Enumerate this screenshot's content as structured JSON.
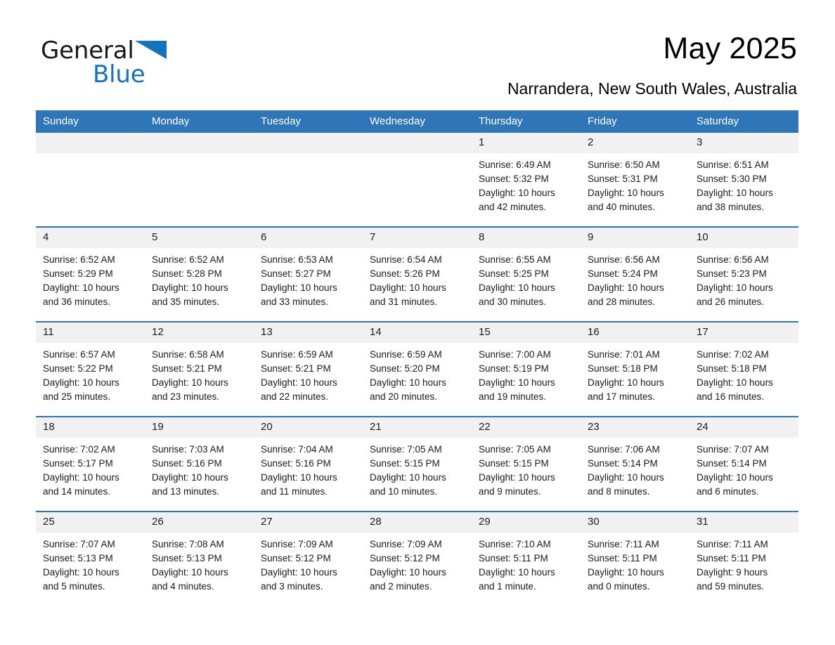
{
  "brand": {
    "name_part1": "General",
    "name_part2": "Blue",
    "accent_color": "#1273bf"
  },
  "header": {
    "month_title": "May 2025",
    "location": "Narrandera, New South Wales, Australia",
    "header_bg_color": "#2f76b8",
    "daynum_bg_color": "#f1f1f1"
  },
  "calendar": {
    "weekday_headers": [
      "Sunday",
      "Monday",
      "Tuesday",
      "Wednesday",
      "Thursday",
      "Friday",
      "Saturday"
    ],
    "weeks": [
      [
        {
          "day": "",
          "sunrise": "",
          "sunset": "",
          "daylight_line1": "",
          "daylight_line2": ""
        },
        {
          "day": "",
          "sunrise": "",
          "sunset": "",
          "daylight_line1": "",
          "daylight_line2": ""
        },
        {
          "day": "",
          "sunrise": "",
          "sunset": "",
          "daylight_line1": "",
          "daylight_line2": ""
        },
        {
          "day": "",
          "sunrise": "",
          "sunset": "",
          "daylight_line1": "",
          "daylight_line2": ""
        },
        {
          "day": "1",
          "sunrise": "Sunrise: 6:49 AM",
          "sunset": "Sunset: 5:32 PM",
          "daylight_line1": "Daylight: 10 hours",
          "daylight_line2": "and 42 minutes."
        },
        {
          "day": "2",
          "sunrise": "Sunrise: 6:50 AM",
          "sunset": "Sunset: 5:31 PM",
          "daylight_line1": "Daylight: 10 hours",
          "daylight_line2": "and 40 minutes."
        },
        {
          "day": "3",
          "sunrise": "Sunrise: 6:51 AM",
          "sunset": "Sunset: 5:30 PM",
          "daylight_line1": "Daylight: 10 hours",
          "daylight_line2": "and 38 minutes."
        }
      ],
      [
        {
          "day": "4",
          "sunrise": "Sunrise: 6:52 AM",
          "sunset": "Sunset: 5:29 PM",
          "daylight_line1": "Daylight: 10 hours",
          "daylight_line2": "and 36 minutes."
        },
        {
          "day": "5",
          "sunrise": "Sunrise: 6:52 AM",
          "sunset": "Sunset: 5:28 PM",
          "daylight_line1": "Daylight: 10 hours",
          "daylight_line2": "and 35 minutes."
        },
        {
          "day": "6",
          "sunrise": "Sunrise: 6:53 AM",
          "sunset": "Sunset: 5:27 PM",
          "daylight_line1": "Daylight: 10 hours",
          "daylight_line2": "and 33 minutes."
        },
        {
          "day": "7",
          "sunrise": "Sunrise: 6:54 AM",
          "sunset": "Sunset: 5:26 PM",
          "daylight_line1": "Daylight: 10 hours",
          "daylight_line2": "and 31 minutes."
        },
        {
          "day": "8",
          "sunrise": "Sunrise: 6:55 AM",
          "sunset": "Sunset: 5:25 PM",
          "daylight_line1": "Daylight: 10 hours",
          "daylight_line2": "and 30 minutes."
        },
        {
          "day": "9",
          "sunrise": "Sunrise: 6:56 AM",
          "sunset": "Sunset: 5:24 PM",
          "daylight_line1": "Daylight: 10 hours",
          "daylight_line2": "and 28 minutes."
        },
        {
          "day": "10",
          "sunrise": "Sunrise: 6:56 AM",
          "sunset": "Sunset: 5:23 PM",
          "daylight_line1": "Daylight: 10 hours",
          "daylight_line2": "and 26 minutes."
        }
      ],
      [
        {
          "day": "11",
          "sunrise": "Sunrise: 6:57 AM",
          "sunset": "Sunset: 5:22 PM",
          "daylight_line1": "Daylight: 10 hours",
          "daylight_line2": "and 25 minutes."
        },
        {
          "day": "12",
          "sunrise": "Sunrise: 6:58 AM",
          "sunset": "Sunset: 5:21 PM",
          "daylight_line1": "Daylight: 10 hours",
          "daylight_line2": "and 23 minutes."
        },
        {
          "day": "13",
          "sunrise": "Sunrise: 6:59 AM",
          "sunset": "Sunset: 5:21 PM",
          "daylight_line1": "Daylight: 10 hours",
          "daylight_line2": "and 22 minutes."
        },
        {
          "day": "14",
          "sunrise": "Sunrise: 6:59 AM",
          "sunset": "Sunset: 5:20 PM",
          "daylight_line1": "Daylight: 10 hours",
          "daylight_line2": "and 20 minutes."
        },
        {
          "day": "15",
          "sunrise": "Sunrise: 7:00 AM",
          "sunset": "Sunset: 5:19 PM",
          "daylight_line1": "Daylight: 10 hours",
          "daylight_line2": "and 19 minutes."
        },
        {
          "day": "16",
          "sunrise": "Sunrise: 7:01 AM",
          "sunset": "Sunset: 5:18 PM",
          "daylight_line1": "Daylight: 10 hours",
          "daylight_line2": "and 17 minutes."
        },
        {
          "day": "17",
          "sunrise": "Sunrise: 7:02 AM",
          "sunset": "Sunset: 5:18 PM",
          "daylight_line1": "Daylight: 10 hours",
          "daylight_line2": "and 16 minutes."
        }
      ],
      [
        {
          "day": "18",
          "sunrise": "Sunrise: 7:02 AM",
          "sunset": "Sunset: 5:17 PM",
          "daylight_line1": "Daylight: 10 hours",
          "daylight_line2": "and 14 minutes."
        },
        {
          "day": "19",
          "sunrise": "Sunrise: 7:03 AM",
          "sunset": "Sunset: 5:16 PM",
          "daylight_line1": "Daylight: 10 hours",
          "daylight_line2": "and 13 minutes."
        },
        {
          "day": "20",
          "sunrise": "Sunrise: 7:04 AM",
          "sunset": "Sunset: 5:16 PM",
          "daylight_line1": "Daylight: 10 hours",
          "daylight_line2": "and 11 minutes."
        },
        {
          "day": "21",
          "sunrise": "Sunrise: 7:05 AM",
          "sunset": "Sunset: 5:15 PM",
          "daylight_line1": "Daylight: 10 hours",
          "daylight_line2": "and 10 minutes."
        },
        {
          "day": "22",
          "sunrise": "Sunrise: 7:05 AM",
          "sunset": "Sunset: 5:15 PM",
          "daylight_line1": "Daylight: 10 hours",
          "daylight_line2": "and 9 minutes."
        },
        {
          "day": "23",
          "sunrise": "Sunrise: 7:06 AM",
          "sunset": "Sunset: 5:14 PM",
          "daylight_line1": "Daylight: 10 hours",
          "daylight_line2": "and 8 minutes."
        },
        {
          "day": "24",
          "sunrise": "Sunrise: 7:07 AM",
          "sunset": "Sunset: 5:14 PM",
          "daylight_line1": "Daylight: 10 hours",
          "daylight_line2": "and 6 minutes."
        }
      ],
      [
        {
          "day": "25",
          "sunrise": "Sunrise: 7:07 AM",
          "sunset": "Sunset: 5:13 PM",
          "daylight_line1": "Daylight: 10 hours",
          "daylight_line2": "and 5 minutes."
        },
        {
          "day": "26",
          "sunrise": "Sunrise: 7:08 AM",
          "sunset": "Sunset: 5:13 PM",
          "daylight_line1": "Daylight: 10 hours",
          "daylight_line2": "and 4 minutes."
        },
        {
          "day": "27",
          "sunrise": "Sunrise: 7:09 AM",
          "sunset": "Sunset: 5:12 PM",
          "daylight_line1": "Daylight: 10 hours",
          "daylight_line2": "and 3 minutes."
        },
        {
          "day": "28",
          "sunrise": "Sunrise: 7:09 AM",
          "sunset": "Sunset: 5:12 PM",
          "daylight_line1": "Daylight: 10 hours",
          "daylight_line2": "and 2 minutes."
        },
        {
          "day": "29",
          "sunrise": "Sunrise: 7:10 AM",
          "sunset": "Sunset: 5:11 PM",
          "daylight_line1": "Daylight: 10 hours",
          "daylight_line2": "and 1 minute."
        },
        {
          "day": "30",
          "sunrise": "Sunrise: 7:11 AM",
          "sunset": "Sunset: 5:11 PM",
          "daylight_line1": "Daylight: 10 hours",
          "daylight_line2": "and 0 minutes."
        },
        {
          "day": "31",
          "sunrise": "Sunrise: 7:11 AM",
          "sunset": "Sunset: 5:11 PM",
          "daylight_line1": "Daylight: 9 hours",
          "daylight_line2": "and 59 minutes."
        }
      ]
    ]
  }
}
